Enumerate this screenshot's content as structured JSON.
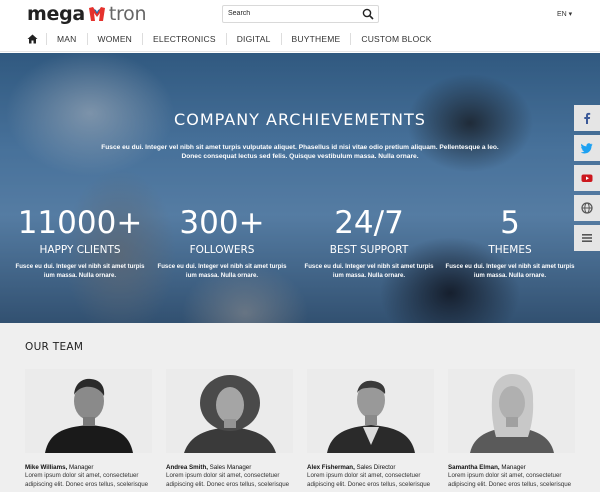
{
  "header": {
    "logo_part1": "mega",
    "logo_part2": "tron",
    "search_placeholder": "Search",
    "language": "EN ▾"
  },
  "nav": {
    "items": [
      "MAN",
      "WOMEN",
      "ELECTRONICS",
      "DIGITAL",
      "BUYTHEME",
      "CUSTOM BLOCK"
    ]
  },
  "hero": {
    "title": "COMPANY ARCHIEVEMETNTS",
    "intro": "Fusce eu dui. Integer vel nibh sit amet turpis vulputate aliquet. Phasellus id nisi vitae odio pretium aliquam. Pellentesque a leo. Donec consequat lectus sed felis. Quisque vestibulum massa. Nulla ornare.",
    "stats": [
      {
        "number": "11000+",
        "label": "HAPPY CLIENTS",
        "desc": "Fusce eu dui. Integer vel nibh sit amet turpis ium massa. Nulla ornare."
      },
      {
        "number": "300+",
        "label": "FOLLOWERS",
        "desc": "Fusce eu dui. Integer vel nibh sit amet turpis ium massa. Nulla ornare."
      },
      {
        "number": "24/7",
        "label": "BEST SUPPORT",
        "desc": "Fusce eu dui. Integer vel nibh sit amet turpis ium massa. Nulla ornare."
      },
      {
        "number": "5",
        "label": "THEMES",
        "desc": "Fusce eu dui. Integer vel nibh sit amet turpis ium massa. Nulla ornare."
      }
    ]
  },
  "social": {
    "icons": [
      "facebook-icon",
      "twitter-icon",
      "youtube-icon",
      "globe-icon",
      "menu-icon"
    ],
    "colors": {
      "facebook": "#3b5998",
      "twitter": "#1da1f2",
      "youtube": "#cc181e",
      "globe": "#555555",
      "menu": "#555555"
    }
  },
  "team": {
    "title": "OUR TEAM",
    "members": [
      {
        "name": "Mike Williams,",
        "role": " Manager",
        "bio": "Lorem ipsum dolor sit amet, consectetuer adipiscing elit. Donec eros tellus, scelerisque"
      },
      {
        "name": "Andrea Smith,",
        "role": " Sales Manager",
        "bio": "Lorem ipsum dolor sit amet, consectetuer adipiscing elit. Donec eros tellus, scelerisque"
      },
      {
        "name": "Alex Fisherman,",
        "role": " Sales Director",
        "bio": "Lorem ipsum dolor sit amet, consectetuer adipiscing elit. Donec eros tellus, scelerisque"
      },
      {
        "name": "Samantha Elman,",
        "role": " Manager",
        "bio": "Lorem ipsum dolor sit amet, consectetuer adipiscing elit. Donec eros tellus, scelerisque"
      }
    ]
  }
}
